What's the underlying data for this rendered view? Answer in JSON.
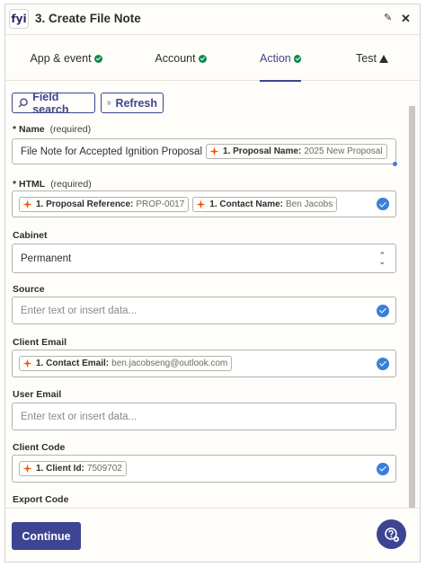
{
  "header": {
    "app_icon_text": "fyi",
    "step_title": "3. Create File Note",
    "edit_icon": "pencil-icon",
    "close_icon": "close-icon"
  },
  "tabs": [
    {
      "label": "App & event",
      "status": "ok"
    },
    {
      "label": "Account",
      "status": "ok"
    },
    {
      "label": "Action",
      "status": "ok",
      "active": true
    },
    {
      "label": "Test",
      "status": "warning"
    }
  ],
  "toolbar": {
    "field_search_label": "Field search",
    "refresh_label": "Refresh"
  },
  "fields": {
    "name": {
      "label": "Name",
      "required": "(required)",
      "text": "File Note for Accepted Ignition Proposal",
      "pill": {
        "key": "1. Proposal Name:",
        "value": "2025 New Proposal"
      }
    },
    "html": {
      "label": "HTML",
      "required": "(required)",
      "pills": [
        {
          "key": "1. Proposal Reference:",
          "value": "PROP-0017"
        },
        {
          "key": "1. Contact Name:",
          "value": "Ben Jacobs"
        }
      ]
    },
    "cabinet": {
      "label": "Cabinet",
      "value": "Permanent"
    },
    "source": {
      "label": "Source",
      "placeholder": "Enter text or insert data..."
    },
    "client_email": {
      "label": "Client Email",
      "pill": {
        "key": "1. Contact Email:",
        "value": "ben.jacobseng@outlook.com"
      }
    },
    "user_email": {
      "label": "User Email",
      "placeholder": "Enter text or insert data..."
    },
    "client_code": {
      "label": "Client Code",
      "pill": {
        "key": "1. Client Id:",
        "value": "7509702"
      }
    },
    "export_code": {
      "label": "Export Code"
    }
  },
  "required_marker": "*",
  "footer": {
    "continue_label": "Continue",
    "help_icon": "help-chat-icon"
  },
  "colors": {
    "accent": "#3d4592",
    "success": "#0f884e",
    "check_blue": "#3980d8",
    "zap_orange": "#ff4f00"
  }
}
